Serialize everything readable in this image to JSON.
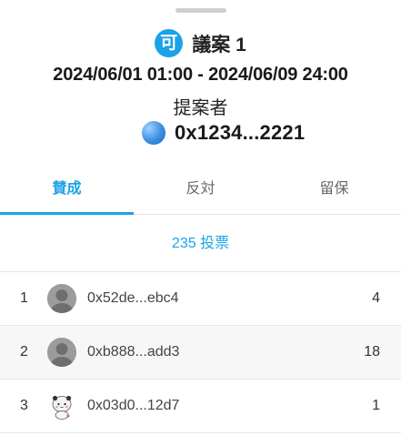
{
  "proposal": {
    "badge": "可",
    "title": "議案 1",
    "period": "2024/06/01 01:00 - 2024/06/09 24:00",
    "proposer_label": "提案者",
    "proposer_address": "0x1234...2221"
  },
  "tabs": [
    {
      "label": "賛成",
      "active": true
    },
    {
      "label": "反対",
      "active": false
    },
    {
      "label": "留保",
      "active": false
    }
  ],
  "vote_count": "235 投票",
  "voters": [
    {
      "rank": "1",
      "address": "0x52de...ebc4",
      "votes": "4",
      "avatar": "default-avatar-icon"
    },
    {
      "rank": "2",
      "address": "0xb888...add3",
      "votes": "18",
      "avatar": "default-avatar-icon"
    },
    {
      "rank": "3",
      "address": "0x03d0...12d7",
      "votes": "1",
      "avatar": "panda-avatar-icon"
    }
  ],
  "colors": {
    "accent": "#1aa3e8"
  }
}
